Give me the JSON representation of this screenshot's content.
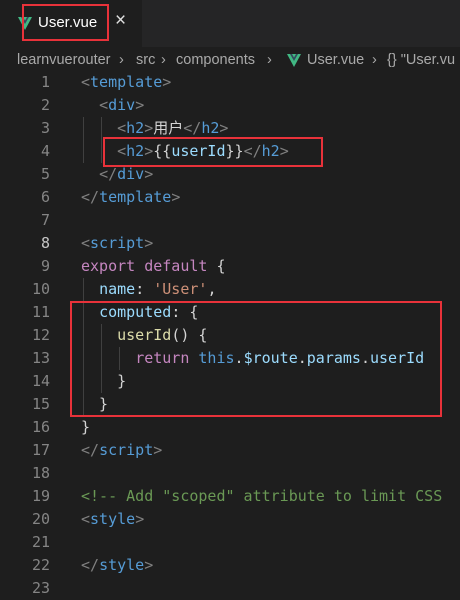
{
  "tab": {
    "title": "User.vue",
    "close": "×"
  },
  "breadcrumb": [
    "learnvuerouter",
    "src",
    "components",
    "User.vue",
    "{} \"User.vu"
  ],
  "code": {
    "numbers": [
      "1",
      "2",
      "3",
      "4",
      "5",
      "6",
      "7",
      "8",
      "9",
      "10",
      "11",
      "12",
      "13",
      "14",
      "15",
      "16",
      "17",
      "18",
      "19",
      "20",
      "21",
      "22",
      "23"
    ],
    "lines": [
      [
        [
          "tg",
          "<"
        ],
        [
          "tn",
          "template"
        ],
        [
          "tg",
          ">"
        ]
      ],
      [
        [
          "pl",
          "  "
        ],
        [
          "tg",
          "<"
        ],
        [
          "tn",
          "div"
        ],
        [
          "tg",
          ">"
        ]
      ],
      [
        [
          "pl",
          "    "
        ],
        [
          "tg",
          "<"
        ],
        [
          "tn",
          "h2"
        ],
        [
          "tg",
          ">"
        ],
        [
          "pl",
          "用户"
        ],
        [
          "tg",
          "</"
        ],
        [
          "tn",
          "h2"
        ],
        [
          "tg",
          ">"
        ]
      ],
      [
        [
          "pl",
          "    "
        ],
        [
          "tg",
          "<"
        ],
        [
          "tn",
          "h2"
        ],
        [
          "tg",
          ">"
        ],
        [
          "pl",
          "{{"
        ],
        [
          "pr",
          "userId"
        ],
        [
          "pl",
          "}}"
        ],
        [
          "tg",
          "</"
        ],
        [
          "tn",
          "h2"
        ],
        [
          "tg",
          ">"
        ]
      ],
      [
        [
          "pl",
          "  "
        ],
        [
          "tg",
          "</"
        ],
        [
          "tn",
          "div"
        ],
        [
          "tg",
          ">"
        ]
      ],
      [
        [
          "tg",
          "</"
        ],
        [
          "tn",
          "template"
        ],
        [
          "tg",
          ">"
        ]
      ],
      [],
      [
        [
          "tg",
          "<"
        ],
        [
          "tn",
          "script"
        ],
        [
          "tg",
          ">"
        ]
      ],
      [
        [
          "kw",
          "export"
        ],
        [
          "pl",
          " "
        ],
        [
          "kw",
          "default"
        ],
        [
          "pl",
          " {"
        ]
      ],
      [
        [
          "pl",
          "  "
        ],
        [
          "pr",
          "name"
        ],
        [
          "pl",
          ": "
        ],
        [
          "st",
          "'User'"
        ],
        [
          "pl",
          ","
        ]
      ],
      [
        [
          "pl",
          "  "
        ],
        [
          "pr",
          "computed"
        ],
        [
          "pl",
          ": {"
        ]
      ],
      [
        [
          "pl",
          "    "
        ],
        [
          "fn",
          "userId"
        ],
        [
          "pl",
          "() {"
        ]
      ],
      [
        [
          "pl",
          "      "
        ],
        [
          "kw",
          "return"
        ],
        [
          "pl",
          " "
        ],
        [
          "tn",
          "this"
        ],
        [
          "pl",
          "."
        ],
        [
          "pr",
          "$route"
        ],
        [
          "pl",
          "."
        ],
        [
          "pr",
          "params"
        ],
        [
          "pl",
          "."
        ],
        [
          "pr",
          "userId"
        ]
      ],
      [
        [
          "pl",
          "    }"
        ]
      ],
      [
        [
          "pl",
          "  }"
        ]
      ],
      [
        [
          "pl",
          "}"
        ]
      ],
      [
        [
          "tg",
          "</"
        ],
        [
          "tn",
          "script"
        ],
        [
          "tg",
          ">"
        ]
      ],
      [],
      [
        [
          "cm",
          "<!-- Add \"scoped\" attribute to limit CSS"
        ]
      ],
      [
        [
          "tg",
          "<"
        ],
        [
          "tn",
          "style"
        ],
        [
          "tg",
          ">"
        ]
      ],
      [],
      [
        [
          "tg",
          "</"
        ],
        [
          "tn",
          "style"
        ],
        [
          "tg",
          ">"
        ]
      ],
      []
    ]
  },
  "colors": {
    "highlight": "#e8323a",
    "vue_green": "#41b883",
    "background": "#1e1e1e"
  }
}
